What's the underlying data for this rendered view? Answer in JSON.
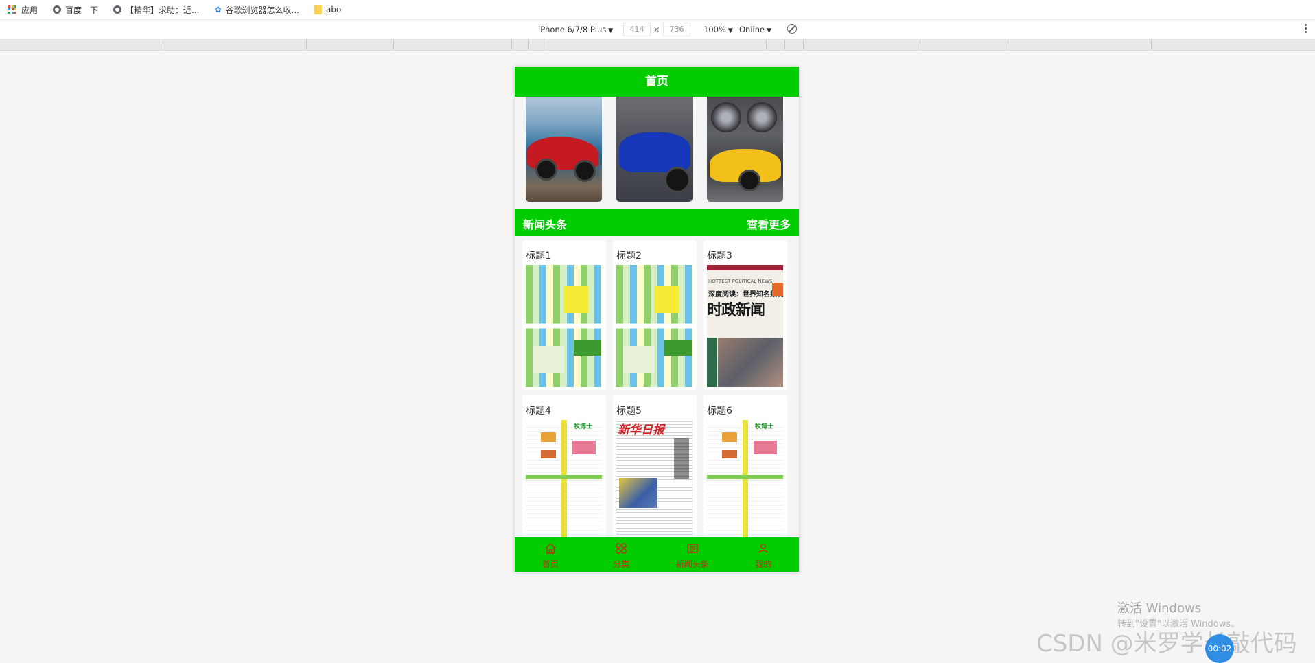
{
  "bookmarks": [
    {
      "label": "应用",
      "icon": "apps-grid-icon"
    },
    {
      "label": "百度一下",
      "icon": "globe-icon"
    },
    {
      "label": "【精华】求助：近...",
      "icon": "globe-icon"
    },
    {
      "label": "谷歌浏览器怎么收...",
      "icon": "baidu-paw-icon"
    },
    {
      "label": "abo",
      "icon": "folder-icon"
    }
  ],
  "devtools": {
    "device": "iPhone 6/7/8 Plus",
    "width": "414",
    "times": "×",
    "height": "736",
    "zoom": "100%",
    "network": "Online"
  },
  "app": {
    "header_title": "首页",
    "section_title": "新闻头条",
    "section_more": "查看更多",
    "cards": [
      {
        "title": "标题1"
      },
      {
        "title": "标题2"
      },
      {
        "title": "标题3"
      },
      {
        "title": "标题4"
      },
      {
        "title": "标题5"
      },
      {
        "title": "标题6"
      }
    ],
    "news_thumb_texts": {
      "headline_small": "深度阅读：世界知名报刊",
      "headline_big": "时政新闻",
      "header_en": "HOTTEST POLITICAL NEWS",
      "paper_mast": "新华日报",
      "paper_brand": "牧博士"
    },
    "tabs": [
      {
        "label": "首页",
        "icon": "home-icon"
      },
      {
        "label": "分类",
        "icon": "category-icon"
      },
      {
        "label": "新闻头条",
        "icon": "news-icon"
      },
      {
        "label": "我的",
        "icon": "user-icon"
      }
    ]
  },
  "watermark": {
    "activate_title": "激活 Windows",
    "activate_sub": "转到\"设置\"以激活 Windows。",
    "csdn": "CSDN @米罗学长敲代码",
    "timer": "00:02"
  },
  "colors": {
    "brand_green": "#00cc00",
    "tab_label_red": "#c8281c"
  }
}
